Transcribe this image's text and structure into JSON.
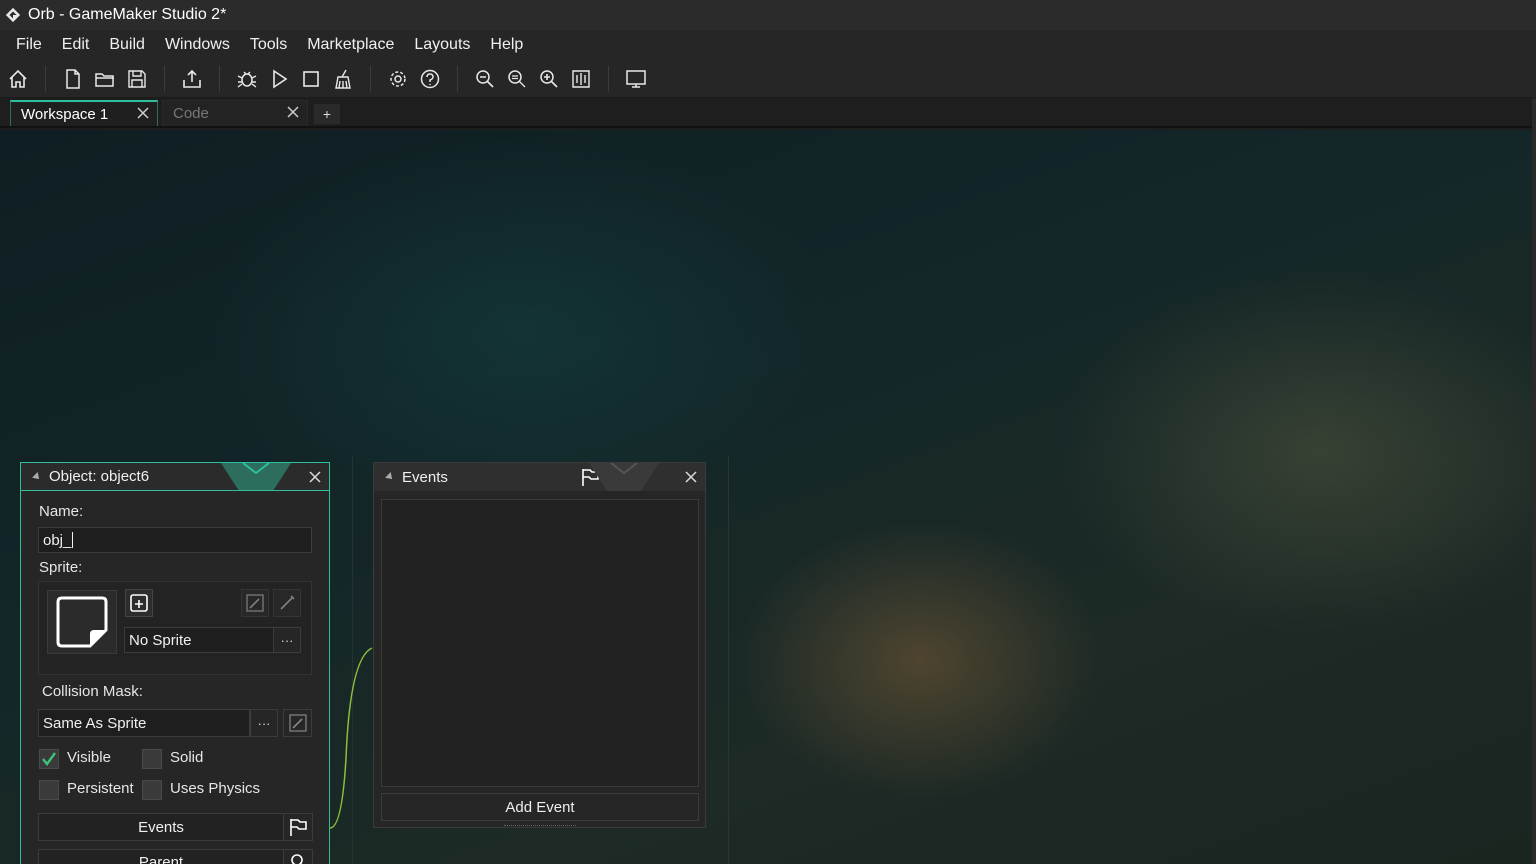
{
  "window": {
    "title": "Orb - GameMaker Studio 2*"
  },
  "menu": [
    "File",
    "Edit",
    "Build",
    "Windows",
    "Tools",
    "Marketplace",
    "Layouts",
    "Help"
  ],
  "toolbar": {
    "icons": [
      "home-icon",
      "new-file-icon",
      "open-folder-icon",
      "save-icon",
      "export-icon",
      "debug-icon",
      "play-icon",
      "stop-icon",
      "clean-icon",
      "settings-icon",
      "help-icon",
      "zoom-out-icon",
      "zoom-reset-icon",
      "zoom-in-icon",
      "fit-icon",
      "monitor-icon"
    ]
  },
  "tabs": [
    {
      "label": "Workspace 1",
      "active": true
    },
    {
      "label": "Code",
      "active": false
    }
  ],
  "tab_add_label": "+",
  "object_panel": {
    "title": "Object: object6",
    "name_label": "Name:",
    "name_value": "obj_",
    "sprite_label": "Sprite:",
    "sprite_value": "No Sprite",
    "dots": "···",
    "collision_label": "Collision Mask:",
    "collision_value": "Same As Sprite",
    "checkboxes": [
      {
        "label": "Visible",
        "checked": true
      },
      {
        "label": "Solid",
        "checked": false
      },
      {
        "label": "Persistent",
        "checked": false
      },
      {
        "label": "Uses Physics",
        "checked": false
      }
    ],
    "events_button": "Events",
    "parent_button": "Parent"
  },
  "events_panel": {
    "title": "Events",
    "add_event": "Add Event"
  },
  "colors": {
    "accent": "#2fbf9c",
    "check": "#3cc47c",
    "curve": "#8bbf3c"
  }
}
